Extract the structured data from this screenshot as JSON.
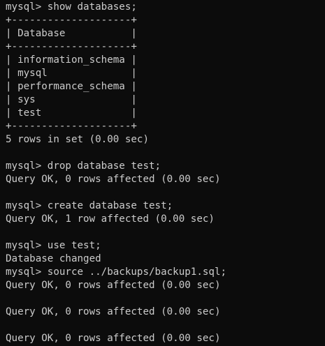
{
  "theme": {
    "background": "#0c0c0c",
    "foreground": "#cccccc"
  },
  "terminal": {
    "lines": [
      "mysql> show databases;",
      "+--------------------+",
      "| Database           |",
      "+--------------------+",
      "| information_schema |",
      "| mysql              |",
      "| performance_schema |",
      "| sys                |",
      "| test               |",
      "+--------------------+",
      "5 rows in set (0.00 sec)",
      "",
      "mysql> drop database test;",
      "Query OK, 0 rows affected (0.00 sec)",
      "",
      "mysql> create database test;",
      "Query OK, 1 row affected (0.00 sec)",
      "",
      "mysql> use test;",
      "Database changed",
      "mysql> source ../backups/backup1.sql;",
      "Query OK, 0 rows affected (0.00 sec)",
      "",
      "Query OK, 0 rows affected (0.00 sec)",
      "",
      "Query OK, 0 rows affected (0.00 sec)"
    ]
  }
}
